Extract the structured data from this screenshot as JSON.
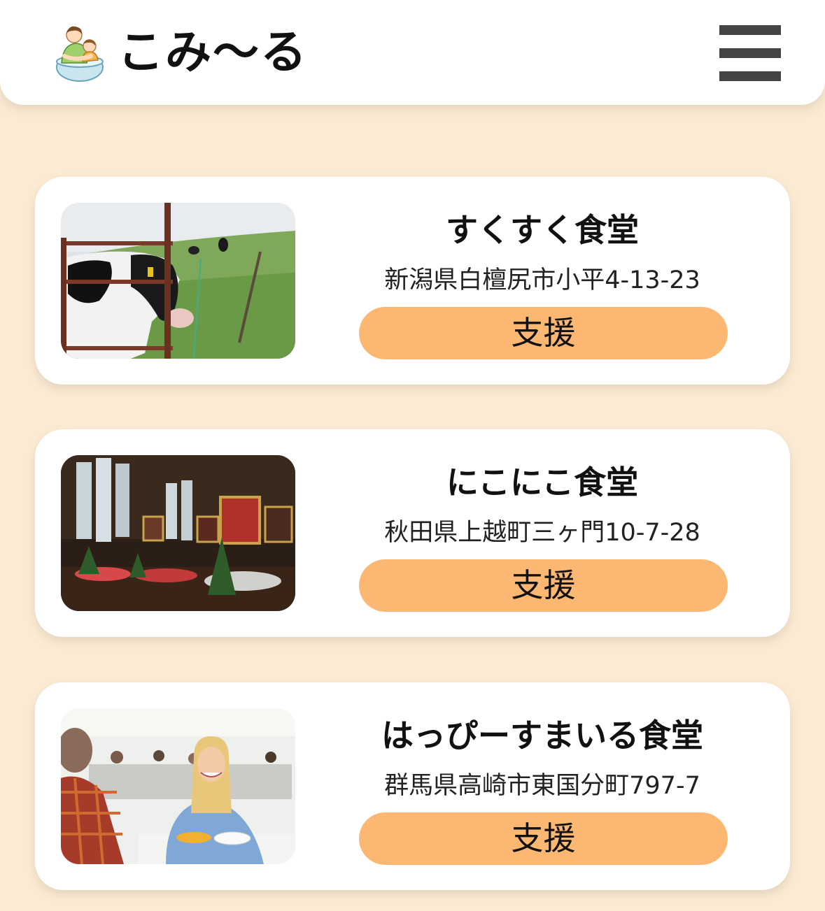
{
  "header": {
    "app_title": "こみ〜る",
    "logo_icon": "parent-hugging-child-logo",
    "menu_icon": "hamburger-menu-icon"
  },
  "cafeterias": [
    {
      "name": "すくすく食堂",
      "address": "新潟県白檀尻市小平4-13-23",
      "photo": "cows-behind-fence-photo",
      "support_label": "支援"
    },
    {
      "name": "にこにこ食堂",
      "address": "秋田県上越町三ヶ門10-7-28",
      "photo": "gothic-dining-hall-photo",
      "support_label": "支援"
    },
    {
      "name": "はっぴーすまいる食堂",
      "address": "群馬県高崎市東国分町797-7",
      "photo": "smiling-woman-cafeteria-photo",
      "support_label": "支援"
    }
  ],
  "colors": {
    "page_background": "#fcebd3",
    "button": "#fcb872",
    "menu_bars": "#444444"
  }
}
